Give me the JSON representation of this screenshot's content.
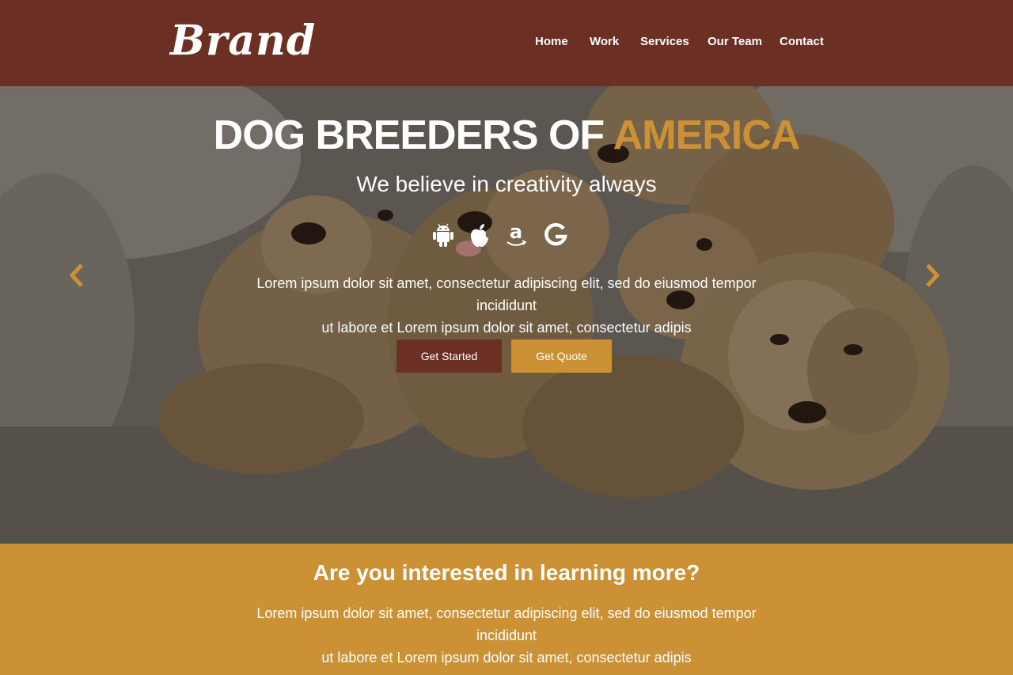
{
  "navbar": {
    "brand": "Brand",
    "items": [
      {
        "label": "Home"
      },
      {
        "label": "Work"
      },
      {
        "label": "Services"
      },
      {
        "label": "Our Team"
      },
      {
        "label": "Contact"
      }
    ],
    "background": "#6b3023"
  },
  "hero": {
    "title_main": "DOG BREEDERS OF ",
    "title_accent": "AMERICA",
    "subtitle": "We believe in creativity always",
    "icons": [
      "android-icon",
      "apple-icon",
      "amazon-icon",
      "google-icon"
    ],
    "text_line1": "Lorem ipsum dolor sit amet, consectetur adipiscing elit, sed do eiusmod tempor incididunt",
    "text_line2": "ut labore et Lorem ipsum dolor sit amet, consectetur adipis",
    "buttons": {
      "start": "Get Started",
      "quote": "Get Quote"
    },
    "arrows": [
      "chevron-left-icon",
      "chevron-right-icon"
    ]
  },
  "cta": {
    "title": "Are you interested in learning more?",
    "text_line1": "Lorem ipsum dolor sit amet, consectetur adipiscing elit, sed do eiusmod tempor incididunt",
    "text_line2": "ut labore et Lorem ipsum dolor sit amet, consectetur adipis"
  },
  "colors": {
    "brown": "#6b3023",
    "gold": "#cc9135",
    "white": "#ffffff"
  }
}
